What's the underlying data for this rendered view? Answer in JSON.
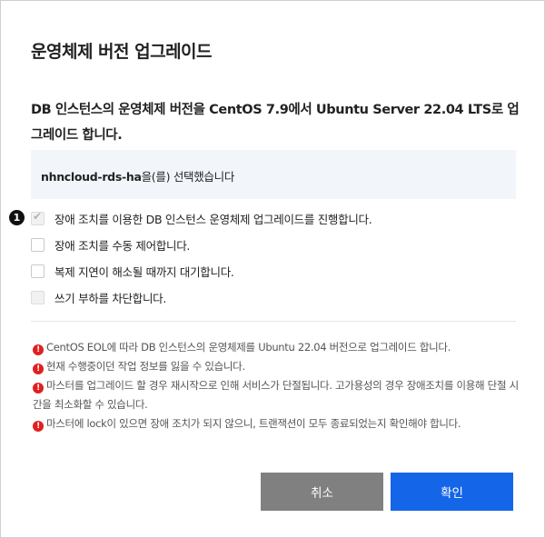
{
  "dialog": {
    "title": "운영체제 버전 업그레이드",
    "description": "DB 인스턴스의 운영체제 버전을 CentOS 7.9에서 Ubuntu Server 22.04 LTS로 업그레이드 합니다.",
    "selected": {
      "name": "nhncloud-rds-ha",
      "suffix": "을(를) 선택했습니다"
    },
    "badge": "1",
    "options": [
      {
        "label": "장애 조치를 이용한 DB 인스턴스 운영체제 업그레이드를 진행합니다.",
        "checked": true,
        "disabled": true
      },
      {
        "label": "장애 조치를 수동 제어합니다.",
        "checked": false,
        "disabled": false
      },
      {
        "label": "복제 지연이 해소될 때까지 대기합니다.",
        "checked": false,
        "disabled": false
      },
      {
        "label": "쓰기 부하를 차단합니다.",
        "checked": false,
        "disabled": true
      }
    ],
    "notices": [
      "CentOS EOL에 따라 DB 인스턴스의 운영체제를 Ubuntu 22.04 버전으로 업그레이드 합니다.",
      "현재 수행중이던 작업 정보를 잃을 수 있습니다.",
      "마스터를 업그레이드 할 경우 재시작으로 인해 서비스가 단절됩니다. 고가용성의 경우 장애조치를 이용해 단절 시간을 최소화할 수 있습니다.",
      "마스터에 lock이 있으면 장애 조치가 되지 않으니, 트랜잭션이 모두 종료되었는지 확인해야 합니다."
    ],
    "buttons": {
      "cancel": "취소",
      "confirm": "확인"
    }
  },
  "colors": {
    "primary": "#1565e9",
    "cancel": "#808080",
    "warning": "#e02020",
    "selected_bg": "#f2f6fb"
  },
  "icons": {
    "warning": "exclamation-circle-icon",
    "check": "check-icon"
  }
}
